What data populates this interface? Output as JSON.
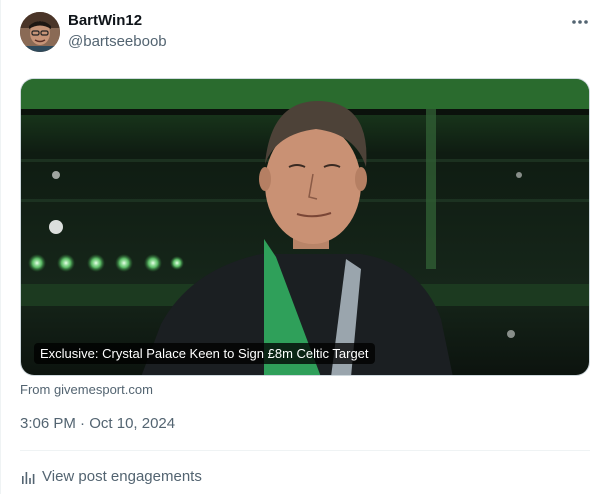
{
  "author": {
    "display_name": "BartWin12",
    "handle": "@bartseeboob"
  },
  "media_card": {
    "caption": "Exclusive: Crystal Palace Keen to Sign £8m Celtic Target",
    "source": "From givemesport.com"
  },
  "timestamp": {
    "time": "3:06 PM",
    "separator": " · ",
    "date": "Oct 10, 2024"
  },
  "engagements": {
    "label": "View post engagements",
    "icon": "bar-chart-icon"
  },
  "colors": {
    "text_primary": "#0f1419",
    "text_secondary": "#536471",
    "border": "#cfd9de",
    "divider": "#eff3f4"
  }
}
